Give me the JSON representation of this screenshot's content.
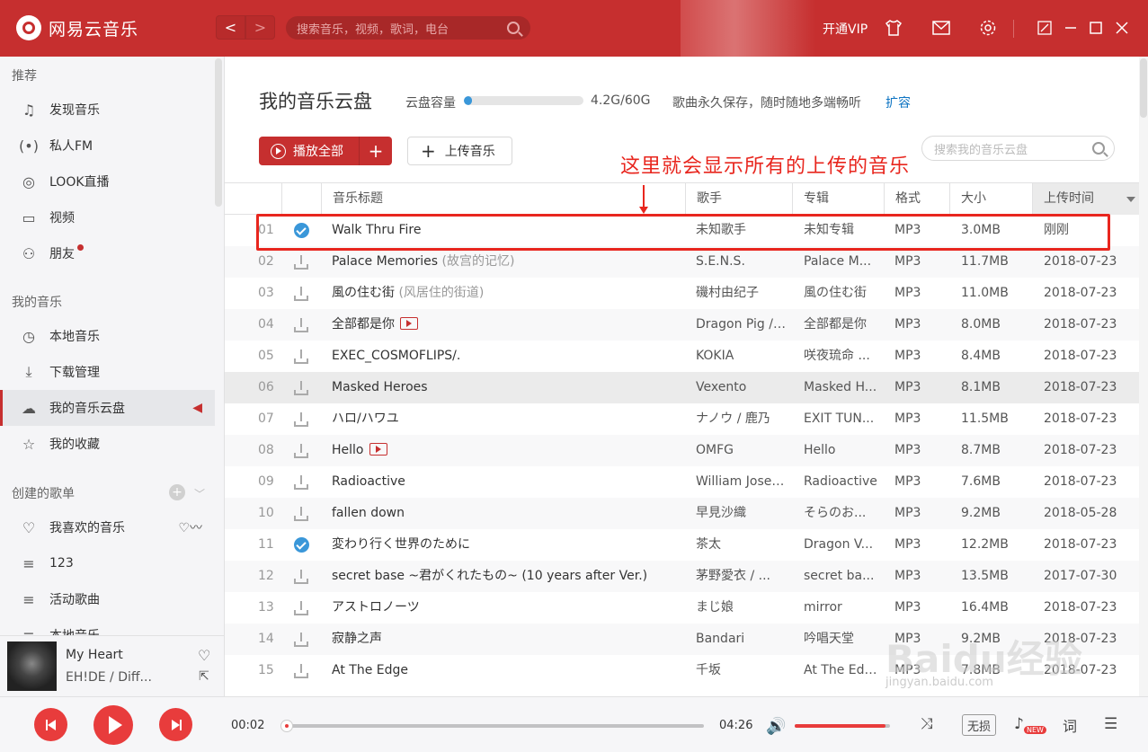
{
  "app": {
    "name": "网易云音乐",
    "search_placeholder": "搜索音乐，视频，歌词，电台",
    "vip_label": "开通VIP",
    "nav_back": "<",
    "nav_forward": ">"
  },
  "sidebar": {
    "section_recommend": "推荐",
    "recommend_items": [
      {
        "label": "发现音乐",
        "icon": "music-note-icon"
      },
      {
        "label": "私人FM",
        "icon": "radio-icon"
      },
      {
        "label": "LOOK直播",
        "icon": "live-icon"
      },
      {
        "label": "视频",
        "icon": "video-icon"
      },
      {
        "label": "朋友",
        "icon": "friends-icon"
      }
    ],
    "section_my_music": "我的音乐",
    "my_music_items": [
      {
        "label": "本地音乐",
        "icon": "clock-icon"
      },
      {
        "label": "下载管理",
        "icon": "download-icon"
      },
      {
        "label": "我的音乐云盘",
        "icon": "cloud-icon",
        "active": true
      },
      {
        "label": "我的收藏",
        "icon": "collection-icon"
      }
    ],
    "section_playlists": "创建的歌单",
    "playlists": [
      {
        "label": "我喜欢的音乐",
        "icon": "heart-icon"
      },
      {
        "label": "123",
        "icon": "playlist-icon"
      },
      {
        "label": "活动歌曲",
        "icon": "playlist-icon"
      },
      {
        "label": "本地音乐",
        "icon": "playlist-icon"
      }
    ]
  },
  "now_playing": {
    "title": "My Heart",
    "artist": "EH!DE / Diff..."
  },
  "cloud": {
    "title": "我的音乐云盘",
    "capacity_label": "云盘容量",
    "capacity_used_fraction": 0.07,
    "capacity_value": "4.2G/60G",
    "description": "歌曲永久保存，随时随地多端畅听",
    "expand_label": "扩容",
    "play_all_label": "播放全部",
    "add_label": "+",
    "upload_label": "上传音乐",
    "search_placeholder": "搜索我的音乐云盘"
  },
  "annotation": {
    "text": "这里就会显示所有的上传的音乐"
  },
  "table": {
    "headers": {
      "title": "音乐标题",
      "artist": "歌手",
      "album": "专辑",
      "format": "格式",
      "size": "大小",
      "upload_time": "上传时间"
    },
    "rows": [
      {
        "num": "01",
        "status": "uploaded",
        "title": "Walk Thru Fire",
        "subtitle": "",
        "mv": false,
        "artist": "未知歌手",
        "album": "未知专辑",
        "format": "MP3",
        "size": "3.0MB",
        "time": "刚刚"
      },
      {
        "num": "02",
        "status": "download",
        "title": "Palace Memories",
        "subtitle": "(故宫的记忆)",
        "mv": false,
        "artist": "S.E.N.S.",
        "album": "Palace M...",
        "format": "MP3",
        "size": "11.7MB",
        "time": "2018-07-23"
      },
      {
        "num": "03",
        "status": "download",
        "title": "風の住む街",
        "subtitle": "(风居住的街道)",
        "mv": false,
        "artist": "磯村由纪子",
        "album": "風の住む街",
        "format": "MP3",
        "size": "11.0MB",
        "time": "2018-07-23"
      },
      {
        "num": "04",
        "status": "download",
        "title": "全部都是你",
        "subtitle": "",
        "mv": true,
        "artist": "Dragon Pig / ...",
        "album": "全部都是你",
        "format": "MP3",
        "size": "8.0MB",
        "time": "2018-07-23"
      },
      {
        "num": "05",
        "status": "download",
        "title": "EXEC_COSMOFLIPS/.",
        "subtitle": "",
        "mv": false,
        "artist": "KOKIA",
        "album": "咲夜琉命 ...",
        "format": "MP3",
        "size": "8.4MB",
        "time": "2018-07-23"
      },
      {
        "num": "06",
        "status": "download",
        "title": "Masked Heroes",
        "subtitle": "",
        "mv": false,
        "artist": "Vexento",
        "album": "Masked H...",
        "format": "MP3",
        "size": "8.1MB",
        "time": "2018-07-23"
      },
      {
        "num": "07",
        "status": "download",
        "title": "ハロ/ハワユ",
        "subtitle": "",
        "mv": false,
        "artist": "ナノウ / 鹿乃",
        "album": "EXIT TUN...",
        "format": "MP3",
        "size": "11.5MB",
        "time": "2018-07-23"
      },
      {
        "num": "08",
        "status": "download",
        "title": "Hello",
        "subtitle": "",
        "mv": true,
        "artist": "OMFG",
        "album": "Hello",
        "format": "MP3",
        "size": "8.7MB",
        "time": "2018-07-23"
      },
      {
        "num": "09",
        "status": "download",
        "title": "Radioactive",
        "subtitle": "",
        "mv": false,
        "artist": "William Joseph",
        "album": "Radioactive",
        "format": "MP3",
        "size": "7.6MB",
        "time": "2018-07-23"
      },
      {
        "num": "10",
        "status": "download",
        "title": "fallen down",
        "subtitle": "",
        "mv": false,
        "artist": "早見沙織",
        "album": "そらのお...",
        "format": "MP3",
        "size": "9.2MB",
        "time": "2018-05-28"
      },
      {
        "num": "11",
        "status": "uploaded",
        "title": "変わり行く世界のために",
        "subtitle": "",
        "mv": false,
        "artist": "茶太",
        "album": "Dragon V...",
        "format": "MP3",
        "size": "12.2MB",
        "time": "2018-07-23"
      },
      {
        "num": "12",
        "status": "download",
        "title": "secret base ~君がくれたもの~ (10 years after Ver.)",
        "subtitle": "",
        "mv": false,
        "artist": "茅野愛衣 / ...",
        "album": "secret ba...",
        "format": "MP3",
        "size": "13.5MB",
        "time": "2017-07-30"
      },
      {
        "num": "13",
        "status": "download",
        "title": "アストロノーツ",
        "subtitle": "",
        "mv": false,
        "artist": "まじ娘",
        "album": "mirror",
        "format": "MP3",
        "size": "16.4MB",
        "time": "2018-07-23"
      },
      {
        "num": "14",
        "status": "download",
        "title": "寂静之声",
        "subtitle": "",
        "mv": false,
        "artist": "Bandari",
        "album": "吟唱天堂",
        "format": "MP3",
        "size": "9.2MB",
        "time": "2018-07-23"
      },
      {
        "num": "15",
        "status": "download",
        "title": "At The Edge",
        "subtitle": "",
        "mv": false,
        "artist": "千坂",
        "album": "At The Edge",
        "format": "MP3",
        "size": "7.8MB",
        "time": "2018-07-23"
      }
    ]
  },
  "player": {
    "current_time": "00:02",
    "total_time": "04:26",
    "progress_fraction": 0.01,
    "volume_fraction": 0.95,
    "lossless_label": "无损",
    "new_badge": "NEW",
    "lyric_label": "词"
  },
  "watermark": {
    "text": "Baidu经验",
    "sub": "jingyan.baidu.com"
  },
  "colors": {
    "brand_red": "#c62f2f",
    "accent_blue": "#3a97d9",
    "annotation_red": "#e8261e"
  }
}
